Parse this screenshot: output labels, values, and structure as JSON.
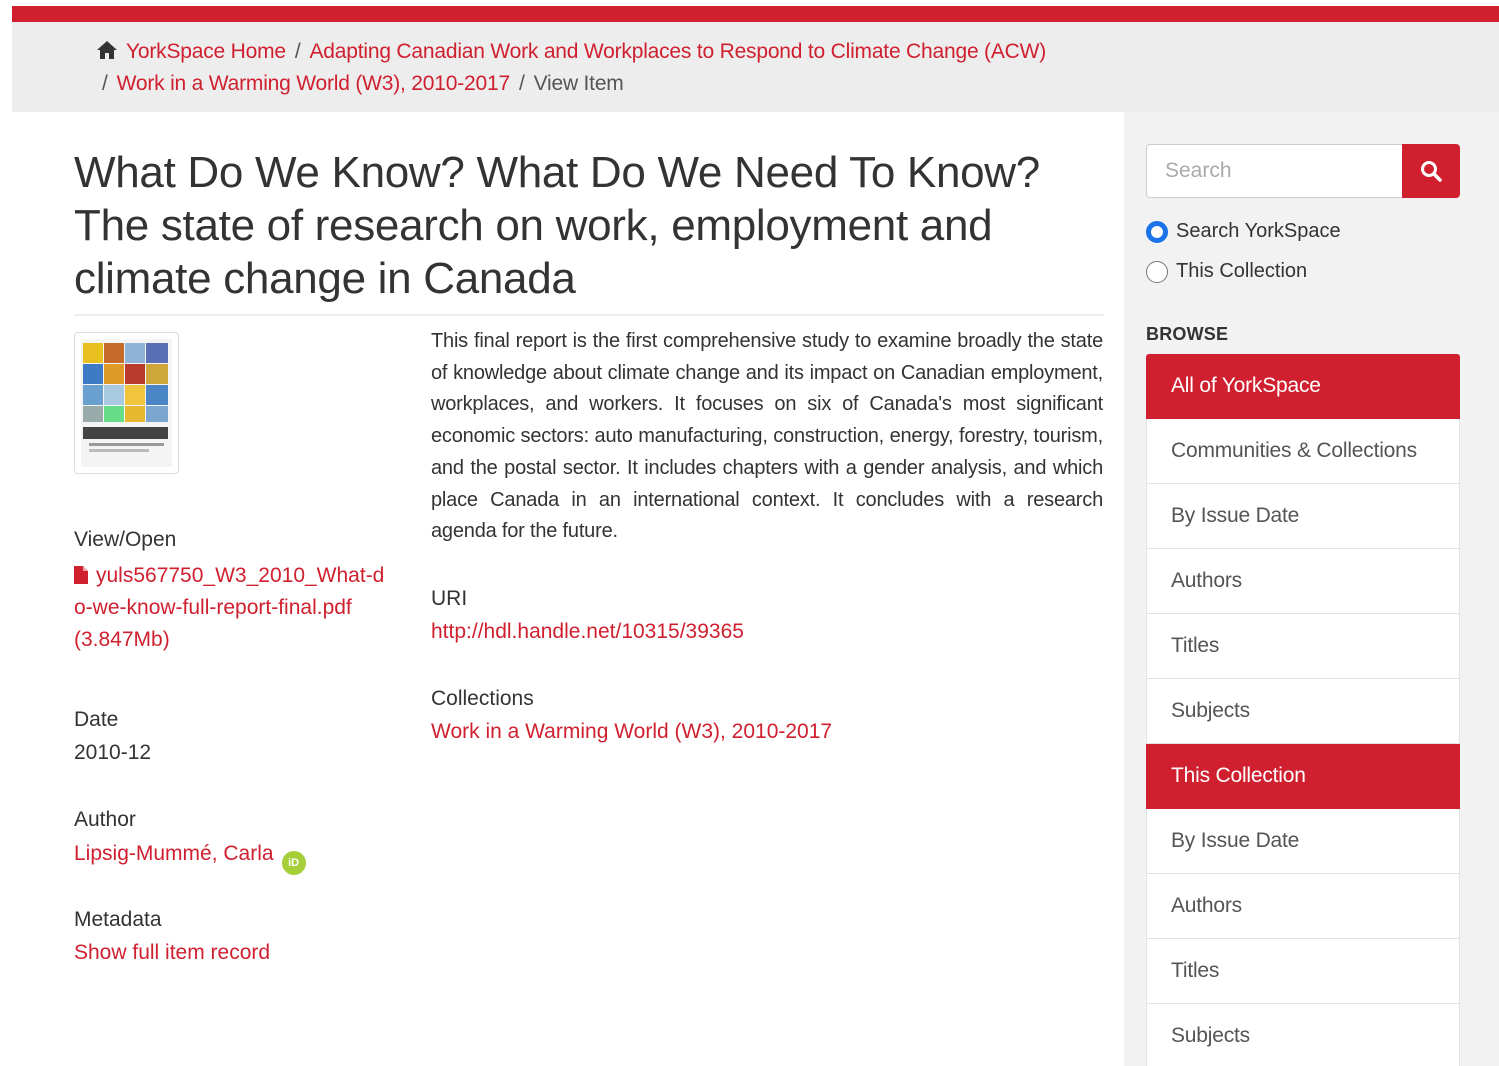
{
  "breadcrumb": {
    "home": "YorkSpace Home",
    "community": "Adapting Canadian Work and Workplaces to Respond to Climate Change (ACW)",
    "collection": "Work in a Warming World (W3), 2010-2017",
    "current": "View Item",
    "separator": "/"
  },
  "item": {
    "title": "What Do We Know? What Do We Need To Know? The state of research on work, employment and climate change in Canada",
    "abstract": "This final report is the first comprehensive study to examine broadly the state of knowledge about climate change and its impact on Canadian employment, workplaces, and workers. It focuses on six of Canada's most significant economic sectors: auto manufacturing, construction, energy, forestry, tourism, and the postal sector. It includes chapters with a gender analysis, and which place Canada in an international context. It concludes with a research agenda for the future.",
    "view_open_label": "View/Open",
    "file_name": "yuls567750_W3_2010_What-do-we-know-full-report-final.pdf",
    "file_size": "(3.847Mb)",
    "date_label": "Date",
    "date_value": "2010-12",
    "author_label": "Author",
    "author_value": "Lipsig-Mummé, Carla",
    "orcid_badge": "iD",
    "metadata_label": "Metadata",
    "metadata_link": "Show full item record",
    "uri_label": "URI",
    "uri_value": "http://hdl.handle.net/10315/39365",
    "collections_label": "Collections",
    "collections_value": "Work in a Warming World (W3), 2010-2017"
  },
  "sidebar": {
    "search_placeholder": "Search",
    "scope_yorkspace": "Search YorkSpace",
    "scope_collection": "This Collection",
    "browse_heading": "BROWSE",
    "all_heading": "All of YorkSpace",
    "all_items": [
      "Communities & Collections",
      "By Issue Date",
      "Authors",
      "Titles",
      "Subjects"
    ],
    "collection_heading": "This Collection",
    "collection_items": [
      "By Issue Date",
      "Authors",
      "Titles",
      "Subjects"
    ]
  },
  "colors": {
    "accent": "#d0202f",
    "band": "#ededed",
    "sidebar": "#f2f2f2",
    "radio_selected": "#1a73e8",
    "orcid": "#a6ce39"
  },
  "icons": [
    "home-icon",
    "search-icon",
    "pdf-icon",
    "orcid-icon"
  ]
}
